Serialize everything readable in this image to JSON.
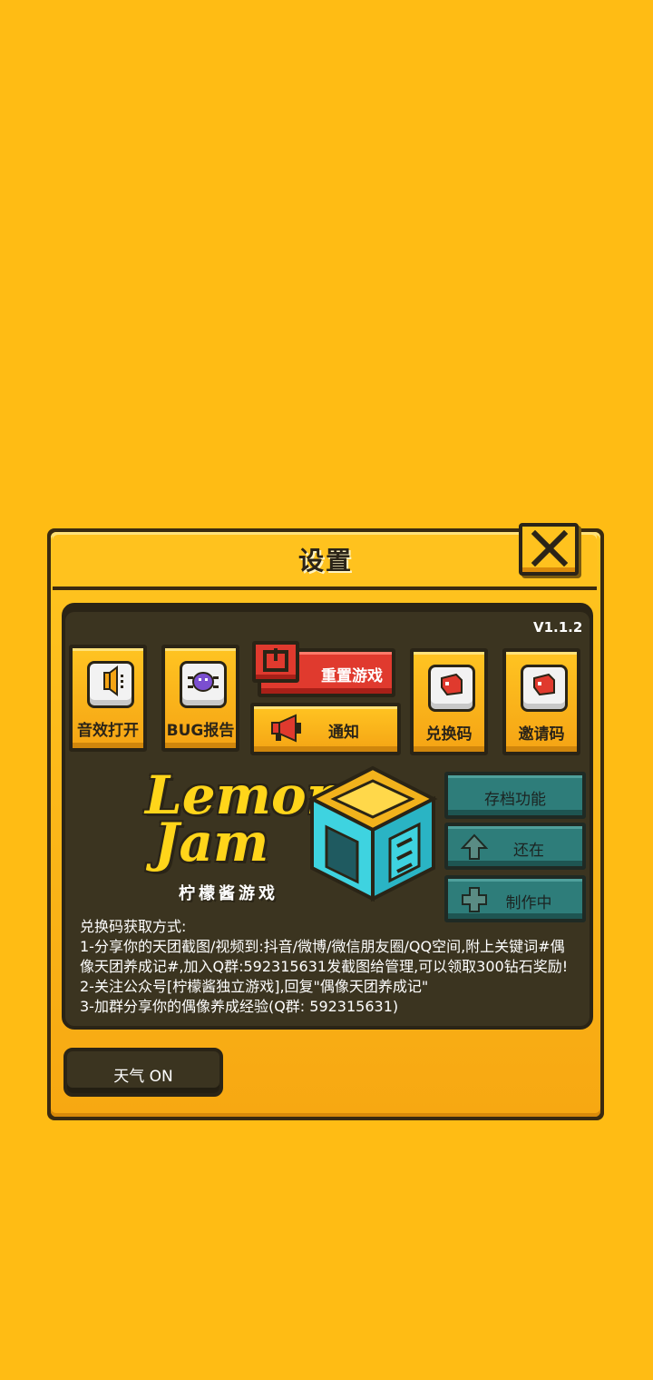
{
  "dialog": {
    "title": "设置",
    "version": "V1.1.2"
  },
  "buttons": {
    "sound": "音效打开",
    "bug_report": "BUG报告",
    "reset_game": "重置游戏",
    "notice": "通知",
    "redeem_code": "兑换码",
    "invite_code": "邀请码"
  },
  "side_buttons": {
    "save": "存档功能",
    "still": "还在",
    "in_progress": "制作中"
  },
  "logo": {
    "text_line1": "Lemon",
    "text_line2": "Jam",
    "subtitle": "柠檬酱游戏"
  },
  "info": {
    "heading": "兑换码获取方式:",
    "lines": [
      "1-分享你的天团截图/视频到:抖音/微博/微信朋友圈/QQ空间,附上关键词#偶",
      "像天团养成记#,加入Q群:592315631发截图给管理,可以领取300钻石奖励!",
      "2-关注公众号[柠檬酱独立游戏],回复\"偶像天团养成记\"",
      "3-加群分享你的偶像养成经验(Q群: 592315631)"
    ]
  },
  "weather_toggle": "天气 ON",
  "colors": {
    "background": "#FFBC14",
    "panel": "#3b3420",
    "reset_red": "#E03A2E",
    "teal": "#2E7D7A"
  }
}
